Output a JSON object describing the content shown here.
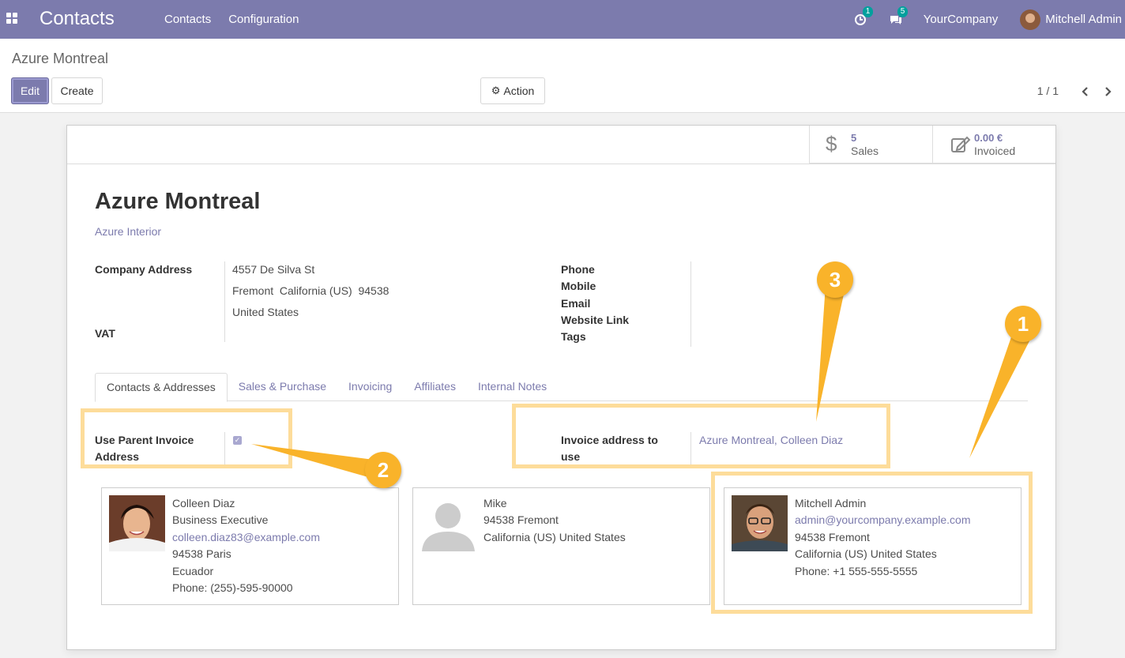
{
  "navbar": {
    "app_title": "Contacts",
    "menu": [
      "Contacts",
      "Configuration"
    ],
    "activity_count": "1",
    "messages_count": "5",
    "company": "YourCompany",
    "user": "Mitchell Admin"
  },
  "control_panel": {
    "breadcrumb": "Azure Montreal",
    "edit_label": "Edit",
    "create_label": "Create",
    "action_label": "Action",
    "pager": "1 / 1"
  },
  "stat_buttons": [
    {
      "value": "5",
      "label": "Sales"
    },
    {
      "value": "0.00 €",
      "label": "Invoiced"
    }
  ],
  "record": {
    "name": "Azure Montreal",
    "parent": "Azure Interior",
    "company_address_label": "Company Address",
    "address_lines": [
      "4557 De Silva St",
      "Fremont  California (US)  94538",
      "United States"
    ],
    "vat_label": "VAT",
    "right_labels": [
      "Phone",
      "Mobile",
      "Email",
      "Website Link",
      "Tags"
    ]
  },
  "tabs": [
    "Contacts & Addresses",
    "Sales & Purchase",
    "Invoicing",
    "Affiliates",
    "Internal Notes"
  ],
  "fields": {
    "use_parent_label_1": "Use Parent Invoice",
    "use_parent_label_2": "Address",
    "invoice_address_label_1": "Invoice address to",
    "invoice_address_label_2": "use",
    "invoice_address_value": "Azure Montreal, Colleen Diaz"
  },
  "contacts": [
    {
      "name": "Colleen Diaz",
      "line2": "Business Executive",
      "email": "colleen.diaz83@example.com",
      "line4": "94538 Paris",
      "line5": "Ecuador",
      "line6": "Phone: (255)-595-90000"
    },
    {
      "name": "Mike",
      "line2": "94538 Fremont",
      "line3": "California (US) United States"
    },
    {
      "name": "Mitchell Admin",
      "email": "admin@yourcompany.example.com",
      "line3": "94538 Fremont",
      "line4": "California (US) United States",
      "line5": "Phone: +1 555-555-5555"
    }
  ],
  "callouts": [
    "1",
    "2",
    "3"
  ],
  "colors": {
    "brand": "#7c7bad",
    "highlight": "#fddc9a",
    "callout": "#f9b32a"
  }
}
